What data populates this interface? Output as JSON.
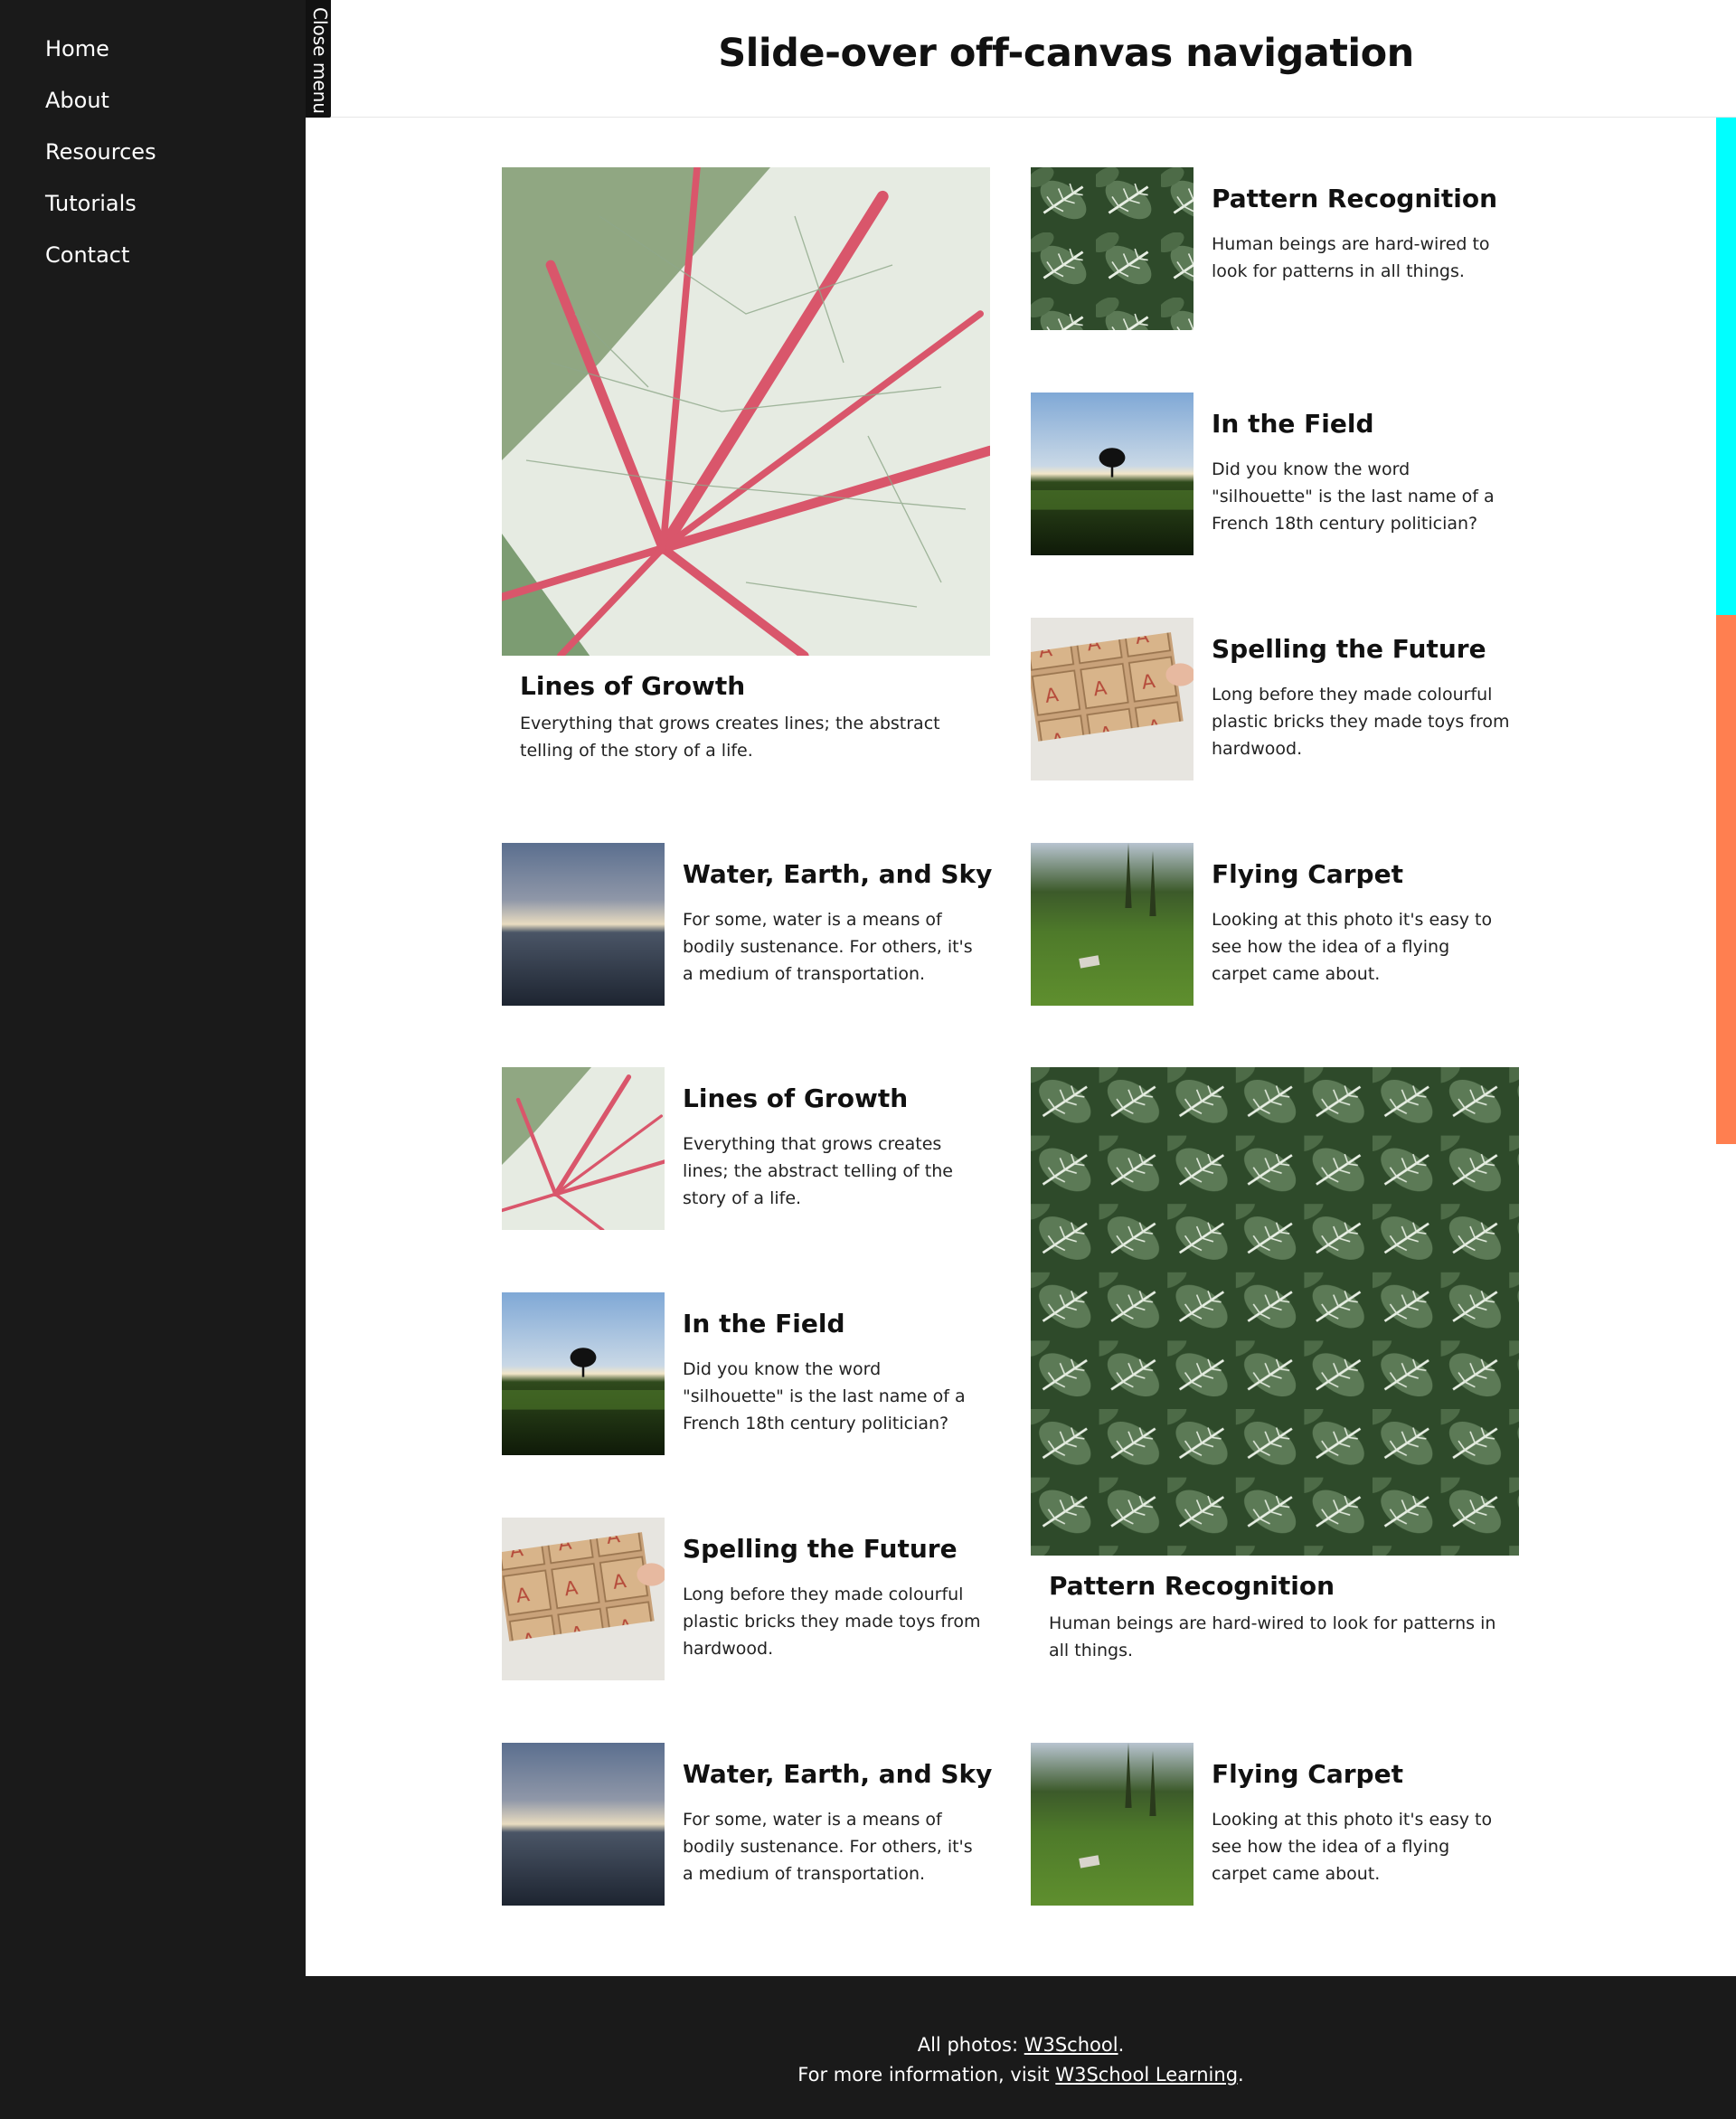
{
  "sidebar": {
    "items": [
      {
        "label": "Home"
      },
      {
        "label": "About"
      },
      {
        "label": "Resources"
      },
      {
        "label": "Tutorials"
      },
      {
        "label": "Contact"
      }
    ],
    "close_label": "Close menu"
  },
  "header": {
    "title": "Slide-over off-canvas navigation"
  },
  "cards": [
    {
      "title": "Lines of Growth",
      "text": "Everything that grows creates lines; the abstract telling of the story of a life.",
      "image": "leaf-photo"
    },
    {
      "title": "Pattern Recognition",
      "text": "Human beings are hard-wired to look for patterns in all things.",
      "image": "plants-photo"
    },
    {
      "title": "In the Field",
      "text": "Did you know the word \"silhouette\" is the last name of a French 18th century politician?",
      "image": "field-tree-photo"
    },
    {
      "title": "Spelling the Future",
      "text": "Long before they made colourful plastic bricks they made toys from hardwood.",
      "image": "wooden-blocks-photo"
    },
    {
      "title": "Water, Earth, and Sky",
      "text": "For some, water is a means of bodily sustenance. For others, it's a medium of transportation.",
      "image": "water-sky-photo"
    },
    {
      "title": "Flying Carpet",
      "text": "Looking at this photo it's easy to see how the idea of a flying carpet came about.",
      "image": "carpet-lawn-photo"
    },
    {
      "title": "Lines of Growth",
      "text": "Everything that grows creates lines; the abstract telling of the story of a life.",
      "image": "leaf-photo"
    },
    {
      "title": "Pattern Recognition",
      "text": "Human beings are hard-wired to look for patterns in all things.",
      "image": "plants-photo"
    },
    {
      "title": "In the Field",
      "text": "Did you know the word \"silhouette\" is the last name of a French 18th century politician?",
      "image": "field-tree-photo"
    },
    {
      "title": "Spelling the Future",
      "text": "Long before they made colourful plastic bricks they made toys from hardwood.",
      "image": "wooden-blocks-photo"
    },
    {
      "title": "Water, Earth, and Sky",
      "text": "For some, water is a means of bodily sustenance. For others, it's a medium of transportation.",
      "image": "water-sky-photo"
    },
    {
      "title": "Flying Carpet",
      "text": "Looking at this photo it's easy to see how the idea of a flying carpet came about.",
      "image": "carpet-lawn-photo"
    }
  ],
  "footer": {
    "photos_prefix": "All photos: ",
    "photos_link": "W3School",
    "photos_suffix": ".",
    "info_prefix": "For more information, visit ",
    "info_link": "W3School Learning",
    "info_suffix": "."
  },
  "colors": {
    "sidebar_bg": "#1a1a1a",
    "scroll_indicator_top": "#00ffff",
    "scroll_indicator_bottom": "#ff7f50"
  }
}
